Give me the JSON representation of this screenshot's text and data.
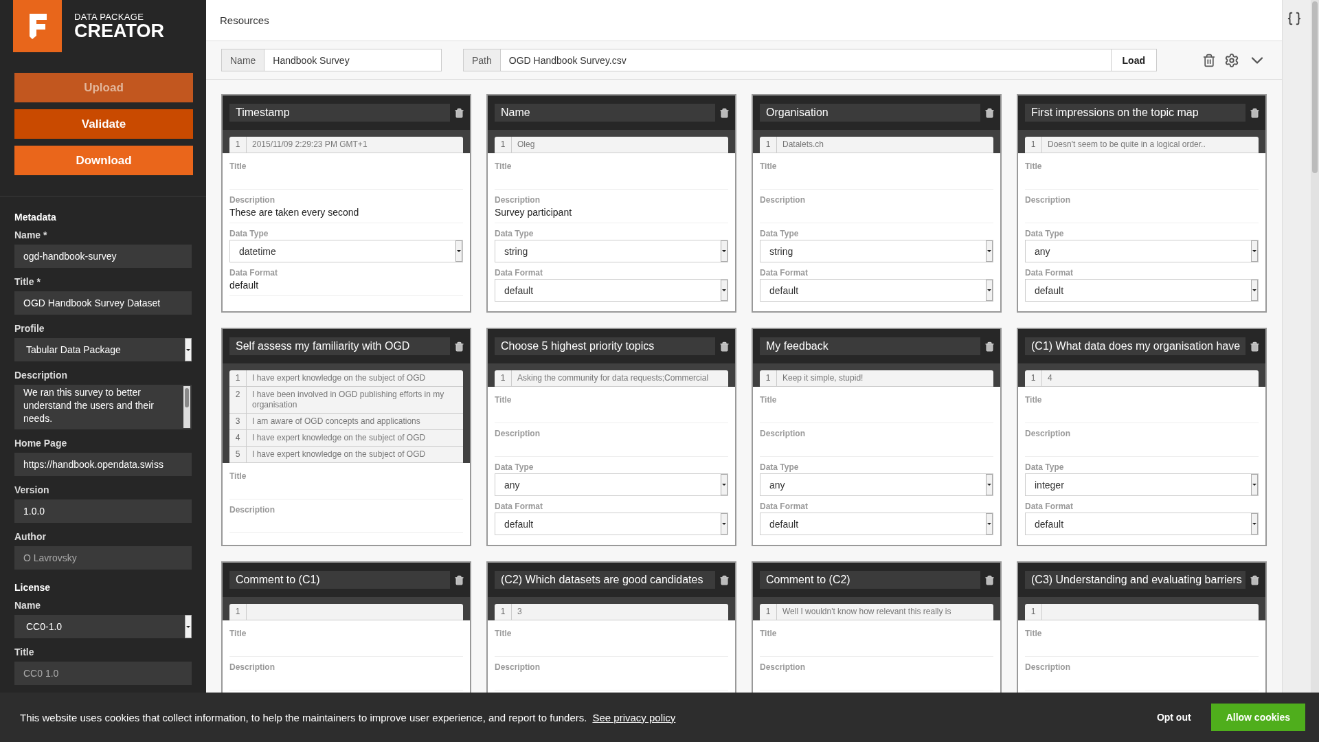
{
  "brand": {
    "top": "DATA PACKAGE",
    "bottom": "CREATOR"
  },
  "sidebar": {
    "buttons": [
      {
        "label": "Upload",
        "color": "#c2571f",
        "disabled": true
      },
      {
        "label": "Validate",
        "color": "#c94a00",
        "disabled": false
      },
      {
        "label": "Download",
        "color": "#ea661b",
        "disabled": false
      }
    ],
    "sections": [
      {
        "heading": "Metadata",
        "fields": [
          {
            "label": "Name *",
            "kind": "text",
            "value": "ogd-handbook-survey"
          },
          {
            "label": "Title *",
            "kind": "text",
            "value": "OGD Handbook Survey Dataset"
          },
          {
            "label": "Profile",
            "kind": "select",
            "value": "Tabular Data Package"
          },
          {
            "label": "Description",
            "kind": "textarea",
            "value": "We ran this survey to better understand the users and their needs."
          },
          {
            "label": "Home Page",
            "kind": "text",
            "value": "https://handbook.opendata.swiss"
          },
          {
            "label": "Version",
            "kind": "text",
            "value": "1.0.0"
          },
          {
            "label": "Author",
            "kind": "text",
            "placeholder": "O Lavrovsky"
          }
        ]
      },
      {
        "heading": "License",
        "fields": [
          {
            "label": "Name",
            "kind": "select",
            "value": "CC0-1.0"
          },
          {
            "label": "Title",
            "kind": "text",
            "placeholder": "CC0 1.0"
          }
        ]
      }
    ]
  },
  "main": {
    "title": "Resources",
    "resource": {
      "name_label": "Name",
      "name": "Handbook Survey",
      "path_label": "Path",
      "path": "OGD Handbook Survey.csv",
      "load": "Load"
    },
    "columns": [
      {
        "name": "Timestamp",
        "preview": [
          {
            "n": "1",
            "text": "2015/11/09 2:29:23 PM GMT+1"
          }
        ],
        "fields": [
          {
            "kind": "inline",
            "label": "Title"
          },
          {
            "kind": "inline",
            "label": "Description",
            "value": "These are taken every second"
          },
          {
            "kind": "select",
            "label": "Data Type",
            "value": "datetime"
          },
          {
            "kind": "inline",
            "label": "Data Format",
            "value": "default"
          }
        ]
      },
      {
        "name": "Name",
        "preview": [
          {
            "n": "1",
            "text": "Oleg"
          }
        ],
        "fields": [
          {
            "kind": "inline",
            "label": "Title"
          },
          {
            "kind": "inline",
            "label": "Description",
            "value": "Survey participant"
          },
          {
            "kind": "select",
            "label": "Data Type",
            "value": "string"
          },
          {
            "kind": "select",
            "label": "Data Format",
            "value": "default"
          }
        ]
      },
      {
        "name": "Organisation",
        "preview": [
          {
            "n": "1",
            "text": "Datalets.ch"
          }
        ],
        "fields": [
          {
            "kind": "inline",
            "label": "Title"
          },
          {
            "kind": "inline",
            "label": "Description"
          },
          {
            "kind": "select",
            "label": "Data Type",
            "value": "string"
          },
          {
            "kind": "select",
            "label": "Data Format",
            "value": "default"
          }
        ]
      },
      {
        "name": "First impressions on the topic map",
        "preview": [
          {
            "n": "1",
            "text": "Doesn't seem to be quite in a logical order.."
          }
        ],
        "fields": [
          {
            "kind": "inline",
            "label": "Title"
          },
          {
            "kind": "inline",
            "label": "Description"
          },
          {
            "kind": "select",
            "label": "Data Type",
            "value": "any"
          },
          {
            "kind": "select",
            "label": "Data Format",
            "value": "default"
          }
        ]
      },
      {
        "name": "Self assess my familiarity with OGD",
        "preview": [
          {
            "n": "1",
            "text": "I have expert knowledge on the subject of OGD"
          },
          {
            "n": "2",
            "text": "I have been involved in OGD publishing efforts in my organisation"
          },
          {
            "n": "3",
            "text": "I am aware of OGD concepts and applications"
          },
          {
            "n": "4",
            "text": "I have expert knowledge on the subject of OGD"
          },
          {
            "n": "5",
            "text": "I have expert knowledge on the subject of OGD"
          }
        ],
        "fields": [
          {
            "kind": "inline",
            "label": "Title"
          },
          {
            "kind": "inline",
            "label": "Description"
          }
        ]
      },
      {
        "name": "Choose 5 highest priority topics",
        "preview": [
          {
            "n": "1",
            "text": "Asking the community for data requests;Commercial"
          }
        ],
        "fields": [
          {
            "kind": "inline",
            "label": "Title"
          },
          {
            "kind": "inline",
            "label": "Description"
          },
          {
            "kind": "select",
            "label": "Data Type",
            "value": "any"
          },
          {
            "kind": "select",
            "label": "Data Format",
            "value": "default"
          }
        ]
      },
      {
        "name": "My feedback",
        "preview": [
          {
            "n": "1",
            "text": "Keep it simple, stupid!"
          }
        ],
        "fields": [
          {
            "kind": "inline",
            "label": "Title"
          },
          {
            "kind": "inline",
            "label": "Description"
          },
          {
            "kind": "select",
            "label": "Data Type",
            "value": "any"
          },
          {
            "kind": "select",
            "label": "Data Format",
            "value": "default"
          }
        ]
      },
      {
        "name": "(C1) What data does my organisation have",
        "preview": [
          {
            "n": "1",
            "text": "4"
          }
        ],
        "fields": [
          {
            "kind": "inline",
            "label": "Title"
          },
          {
            "kind": "inline",
            "label": "Description"
          },
          {
            "kind": "select",
            "label": "Data Type",
            "value": "integer"
          },
          {
            "kind": "select",
            "label": "Data Format",
            "value": "default"
          }
        ]
      },
      {
        "name": "Comment to (C1)",
        "preview": [
          {
            "n": "1"
          }
        ],
        "fields": [
          {
            "kind": "inline",
            "label": "Title"
          },
          {
            "kind": "inline",
            "label": "Description"
          }
        ]
      },
      {
        "name": "(C2) Which datasets are good candidates",
        "preview": [
          {
            "n": "1",
            "text": "3"
          }
        ],
        "fields": [
          {
            "kind": "inline",
            "label": "Title"
          },
          {
            "kind": "inline",
            "label": "Description"
          }
        ]
      },
      {
        "name": "Comment to (C2)",
        "preview": [
          {
            "n": "1",
            "text": "Well I wouldn't know how relevant this really is"
          }
        ],
        "fields": [
          {
            "kind": "inline",
            "label": "Title"
          },
          {
            "kind": "inline",
            "label": "Description"
          }
        ]
      },
      {
        "name": "(C3) Understanding and evaluating barriers",
        "preview": [
          {
            "n": "1"
          }
        ],
        "fields": [
          {
            "kind": "inline",
            "label": "Title"
          },
          {
            "kind": "inline",
            "label": "Description"
          }
        ]
      }
    ]
  },
  "cookie_bar": {
    "message": "This website uses cookies that collect information, to help the maintainers to improve user experience, and report to funders.",
    "link": "See privacy policy",
    "decline": "Opt out",
    "accept": "Allow cookies"
  }
}
